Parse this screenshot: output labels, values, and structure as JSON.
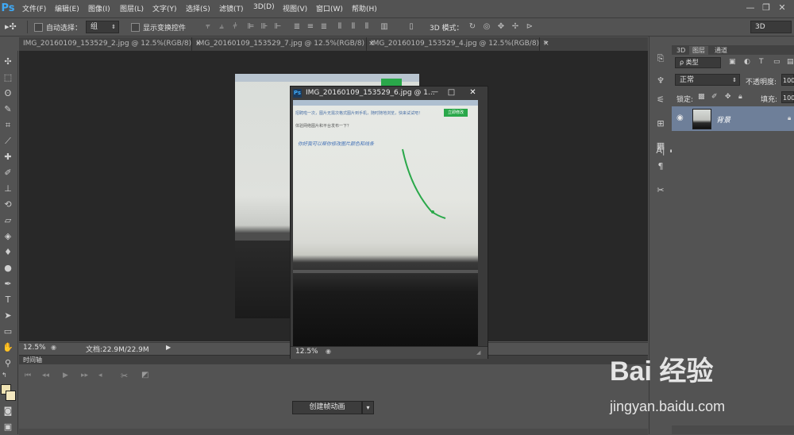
{
  "app": {
    "logo": "Ps"
  },
  "menu": {
    "items": [
      "文件(F)",
      "编辑(E)",
      "图像(I)",
      "图层(L)",
      "文字(Y)",
      "选择(S)",
      "滤镜(T)",
      "3D(D)",
      "视图(V)",
      "窗口(W)",
      "帮助(H)"
    ]
  },
  "window_controls": {
    "minimize": "—",
    "restore": "❐",
    "close": "✕"
  },
  "options": {
    "auto_select_label": "自动选择：",
    "auto_select_value": "组",
    "show_transform_label": "显示变换控件",
    "mode_3d_label": "3D 模式：",
    "workspace_value": "3D"
  },
  "tabs": [
    {
      "label": "IMG_20160109_153529_2.jpg @ 12.5%(RGB/8)",
      "close": "×"
    },
    {
      "label": "IMG_20160109_153529_7.jpg @ 12.5%(RGB/8)",
      "close": "×"
    },
    {
      "label": "IMG_20160109_153529_4.jpg @ 12.5%(RGB/8)",
      "close": "×"
    }
  ],
  "tab_overflow": "»",
  "status": {
    "zoom": "12.5%",
    "doc_info": "文档:22.9M/22.9M"
  },
  "floating_window": {
    "title": "IMG_20160109_153529_6.jpg @ 1...",
    "zoom": "12.5%",
    "controls": {
      "minimize": "—",
      "maximize": "□",
      "close": "✕"
    }
  },
  "photo_text": {
    "line1": "招聘啦一次，图片无需次格式图片到手机，随时随地浏览，快来试试吧！",
    "green_button": "立即修改",
    "line2": "体验网络图片和平台发布一下？",
    "handwriting": "你好我可以帮你修改图片颜色和线条"
  },
  "timeline": {
    "title": "时间轴",
    "create_button": "创建帧动画"
  },
  "layers_panel": {
    "tabs": [
      "3D",
      "图层",
      "通道"
    ],
    "filter_label": "ρ 类型",
    "blend_mode": "正常",
    "opacity_label": "不透明度:",
    "opacity_value": "100",
    "lock_label": "锁定:",
    "fill_label": "填充:",
    "fill_value": "100",
    "layer_name": "背景"
  },
  "watermark": {
    "brand": "Bai 经验",
    "url": "jingyan.baidu.com"
  },
  "colors": {
    "ps_blue": "#3fa9f5",
    "panel_bg": "#535353",
    "canvas_bg": "#282828",
    "selected_layer": "#6e7f99",
    "green_button": "#2aa84a"
  }
}
